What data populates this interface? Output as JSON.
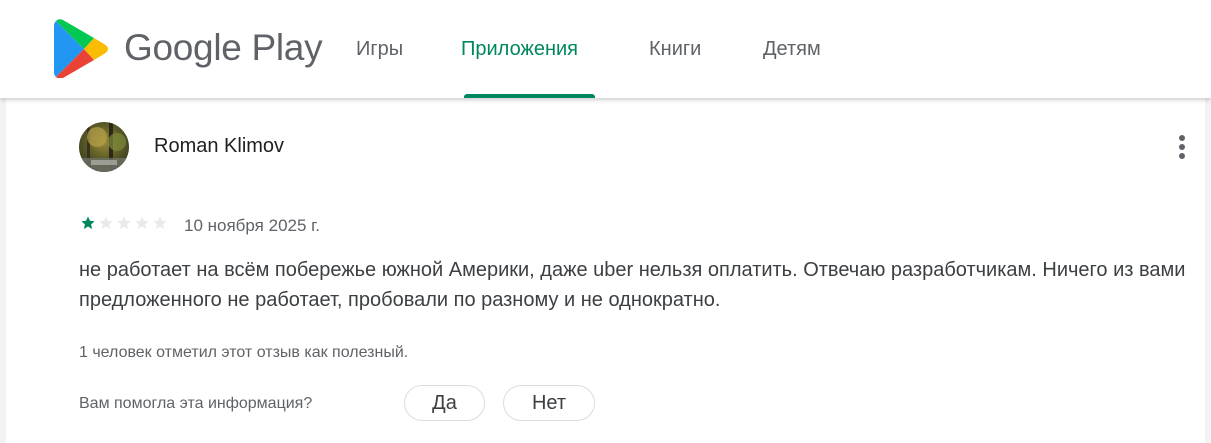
{
  "header": {
    "logo_text": "Google Play",
    "nav": [
      {
        "label": "Игры",
        "active": false
      },
      {
        "label": "Приложения",
        "active": true
      },
      {
        "label": "Книги",
        "active": false
      },
      {
        "label": "Детям",
        "active": false
      }
    ]
  },
  "review": {
    "author": "Roman Klimov",
    "rating": 1,
    "max_rating": 5,
    "date": "10 ноября 2025 г.",
    "text": "не работает на всём побережье южной Америки, даже uber нельзя оплатить. Отвечаю разработчикам. Ничего из вами предложенного не работает, пробовали по разному и не однократно.",
    "helpful_count_text": "1 человек отметил этот отзыв как полезный.",
    "helpful_question": "Вам помогла эта информация?",
    "yes_label": "Да",
    "no_label": "Нет"
  },
  "icons": {
    "logo": "google-play-logo-icon",
    "more": "more-vert-icon",
    "star": "star-icon"
  },
  "colors": {
    "accent": "#01875f",
    "text_secondary": "#5f6368",
    "star_filled": "#01875f",
    "star_empty": "#e8eaed"
  }
}
